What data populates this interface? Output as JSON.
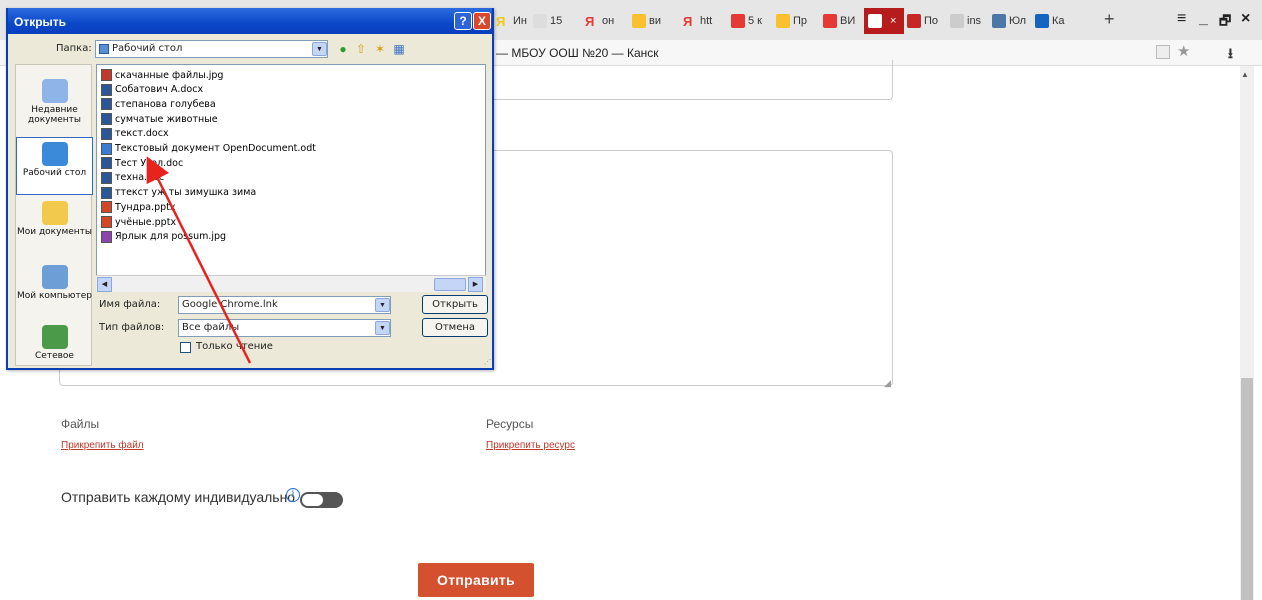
{
  "browser": {
    "tabs": [
      {
        "label": "Ин",
        "color": "#f5c518",
        "glyph": "Я"
      },
      {
        "label": "15",
        "color": "#dddddd"
      },
      {
        "label": "он",
        "color": "#e53935",
        "glyph": "Я"
      },
      {
        "label": "ви",
        "color": "#fbc02d"
      },
      {
        "label": "htt",
        "color": "#e53935",
        "glyph": "Я"
      },
      {
        "label": "5 к",
        "color": "#e53935"
      },
      {
        "label": "Пр",
        "color": "#fbc02d"
      },
      {
        "label": "ВИ",
        "color": "#e53935"
      },
      {
        "label": "",
        "color": "#ffffff",
        "active": true,
        "close": "×"
      },
      {
        "label": "По",
        "color": "#c62828"
      },
      {
        "label": "ins",
        "color": "#cccccc"
      },
      {
        "label": "Юл",
        "color": "#4a76a8"
      },
      {
        "label": "Ка",
        "color": "#1565c0"
      }
    ],
    "new_tab": "+",
    "window_controls": {
      "menu": "≡",
      "minimize": "_",
      "restore": "🗗",
      "close": "×"
    },
    "page_title": "— МБОУ ООШ №20 — Канск",
    "star": "★",
    "download": "⭳"
  },
  "page": {
    "files_label": "Файлы",
    "attach_file": "Прикрепить файл",
    "resources_label": "Ресурсы",
    "attach_resource": "Прикрепить ресурс",
    "individual_label": "Отправить каждому индивидуально",
    "info_icon": "i",
    "toggle_on": false,
    "submit": "Отправить"
  },
  "dialog": {
    "title": "Открыть",
    "help": "?",
    "close": "X",
    "lookin_label": "Папка:",
    "lookin_value": "Рабочий стол",
    "places": [
      {
        "label": "Недавние документы",
        "color": "#8fb4e8"
      },
      {
        "label": "Рабочий стол",
        "color": "#3a8ad9",
        "active": true
      },
      {
        "label": "Мои документы",
        "color": "#f2c94c"
      },
      {
        "label": "Мой компьютер",
        "color": "#6d9fd6"
      },
      {
        "label": "Сетевое",
        "color": "#4a9a4a"
      }
    ],
    "files": [
      {
        "name": "скачанные файлы.jpg",
        "color": "#c0392b"
      },
      {
        "name": "Собатович А.docx",
        "color": "#2b5797"
      },
      {
        "name": "степанова голубева",
        "color": "#2b5797"
      },
      {
        "name": "сумчатые животные",
        "color": "#2b5797"
      },
      {
        "name": "текст.docx",
        "color": "#2b5797"
      },
      {
        "name": "Текстовый документ OpenDocument.odt",
        "color": "#3a7bd5"
      },
      {
        "name": "Тест Угол.doc",
        "color": "#2b5797"
      },
      {
        "name": "техна.doc",
        "color": "#2b5797"
      },
      {
        "name": "ттекст уж ты зимушка зима",
        "color": "#2b5797"
      },
      {
        "name": "Тундра.pptx",
        "color": "#d24726"
      },
      {
        "name": "учёные.pptx",
        "color": "#d24726"
      },
      {
        "name": "Ярлык для possum.jpg",
        "color": "#8e44ad"
      }
    ],
    "filename_label": "Имя файла:",
    "filename_value": "Google Chrome.lnk",
    "filetype_label": "Тип файлов:",
    "filetype_value": "Все файлы",
    "open_button": "Открыть",
    "cancel_button": "Отмена",
    "readonly_label": "Только чтение"
  },
  "colors": {
    "accent": "#d4512f",
    "link": "#c0392b",
    "dialog_title": "#0a48c8",
    "annotation_arrow": "#e8221c"
  }
}
